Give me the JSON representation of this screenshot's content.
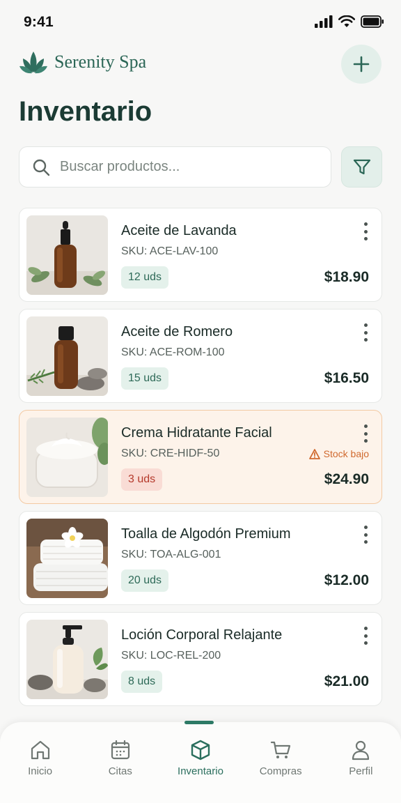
{
  "status_bar": {
    "time": "9:41"
  },
  "header": {
    "brand_name": "Serenity Spa",
    "page_title": "Inventario"
  },
  "search": {
    "placeholder": "Buscar productos...",
    "value": ""
  },
  "colors": {
    "brand": "#2b6656",
    "accent_bg": "#e3efea",
    "low_stock": "#d0692e",
    "low_qty_text": "#b53a2c"
  },
  "products": [
    {
      "name": "Aceite de Lavanda",
      "sku": "SKU: ACE-LAV-100",
      "qty": "12 uds",
      "price": "$18.90",
      "image": "lavender-oil-bottle"
    },
    {
      "name": "Aceite de Romero",
      "sku": "SKU: ACE-ROM-100",
      "qty": "15 uds",
      "price": "$16.50",
      "image": "rosemary-oil-bottle"
    },
    {
      "name": "Crema Hidratante Facial",
      "sku": "SKU: CRE-HIDF-50",
      "qty": "3 uds",
      "price": "$24.90",
      "image": "face-cream-jar",
      "alert": "Stock bajo"
    },
    {
      "name": "Toalla de Algodón Premium",
      "sku": "SKU: TOA-ALG-001",
      "qty": "20 uds",
      "price": "$12.00",
      "image": "folded-towels"
    },
    {
      "name": "Loción Corporal Relajante",
      "sku": "SKU: LOC-REL-200",
      "qty": "8 uds",
      "price": "$21.00",
      "image": "lotion-pump-bottle"
    }
  ],
  "nav": [
    {
      "label": "Inicio",
      "icon": "home-icon",
      "active": false
    },
    {
      "label": "Citas",
      "icon": "calendar-icon",
      "active": false
    },
    {
      "label": "Inventario",
      "icon": "box-icon",
      "active": true
    },
    {
      "label": "Compras",
      "icon": "cart-icon",
      "active": false
    },
    {
      "label": "Perfil",
      "icon": "user-icon",
      "active": false
    }
  ]
}
